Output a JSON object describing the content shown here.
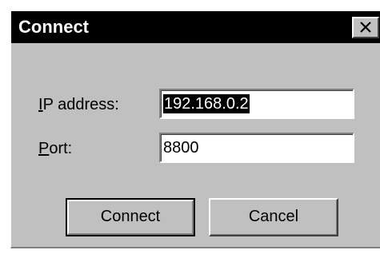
{
  "window": {
    "title": "Connect",
    "close_icon": "close-icon"
  },
  "form": {
    "ip_label": "IP address:",
    "ip_mnemonic": "I",
    "ip_label_rest": "P address:",
    "ip_value": "192.168.0.2",
    "port_label": "Port:",
    "port_mnemonic": "P",
    "port_label_rest": "ort:",
    "port_value": "8800"
  },
  "buttons": {
    "connect_label": "Connect",
    "cancel_label": "Cancel"
  },
  "colors": {
    "titlebar": "#000000",
    "face": "#c0c0c0",
    "field": "#ffffff",
    "selection": "#000000"
  }
}
